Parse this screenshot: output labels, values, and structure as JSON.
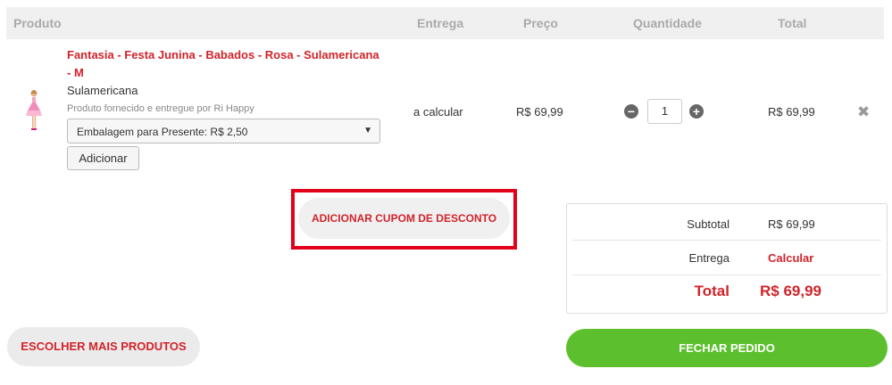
{
  "table_header": {
    "product": "Produto",
    "delivery": "Entrega",
    "price": "Preço",
    "quantity": "Quantidade",
    "total": "Total"
  },
  "item": {
    "name": "Fantasia - Festa Junina - Babados - Rosa - Sulamericana - M",
    "brand": "Sulamericana",
    "seller": "Produto fornecido e entregue por Ri Happy",
    "wrap_option": "Embalagem para Presente: R$ 2,50",
    "add_label": "Adicionar",
    "delivery": "a calcular",
    "price": "R$ 69,99",
    "quantity": "1",
    "total": "R$ 69,99"
  },
  "coupon_label": "ADICIONAR CUPOM DE DESCONTO",
  "summary": {
    "subtotal_label": "Subtotal",
    "subtotal_value": "R$ 69,99",
    "delivery_label": "Entrega",
    "delivery_value": "Calcular",
    "total_label": "Total",
    "total_value": "R$ 69,99"
  },
  "actions": {
    "more_products": "ESCOLHER MAIS PRODUTOS",
    "checkout": "FECHAR PEDIDO"
  },
  "colors": {
    "accent_red": "#d0242b",
    "checkout_green": "#5cc02e",
    "highlight_red": "#e3001b"
  }
}
